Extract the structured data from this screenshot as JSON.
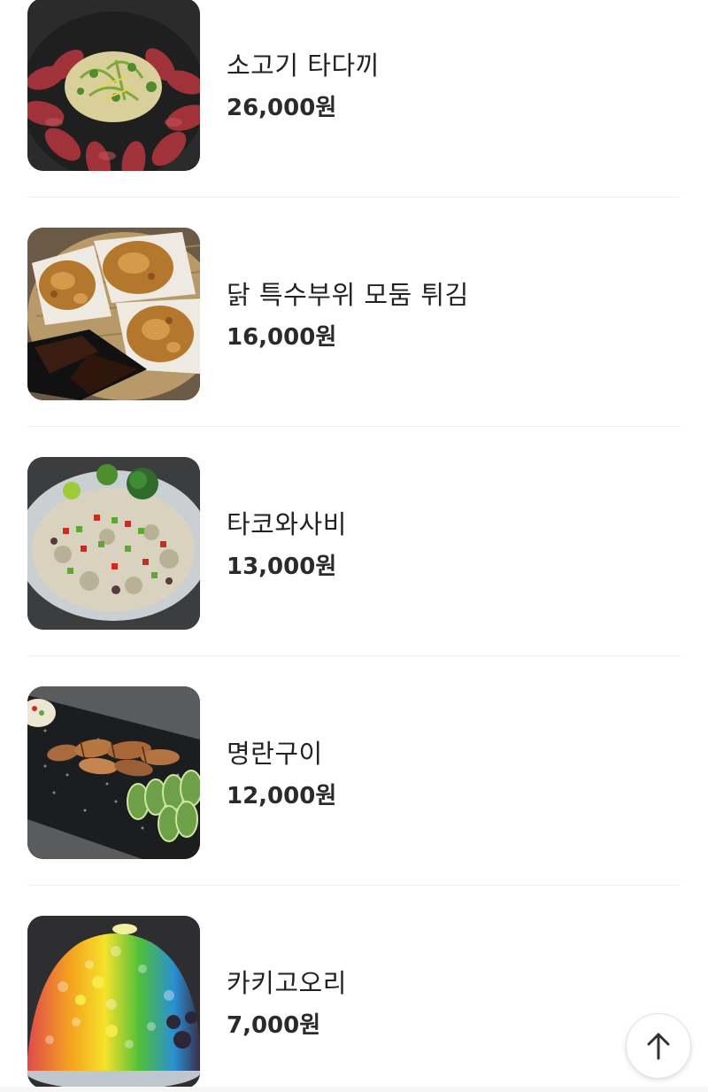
{
  "menu": {
    "items": [
      {
        "name": "소고기 타다끼",
        "price": "26,000원",
        "photo_icon": "beef-tataki-photo"
      },
      {
        "name": "닭 특수부위 모둠 튀김",
        "price": "16,000원",
        "photo_icon": "fried-chicken-photo"
      },
      {
        "name": "타코와사비",
        "price": "13,000원",
        "photo_icon": "tako-wasabi-photo"
      },
      {
        "name": "명란구이",
        "price": "12,000원",
        "photo_icon": "grilled-pollack-roe-photo"
      },
      {
        "name": "카키고오리",
        "price": "7,000원",
        "photo_icon": "kakigori-photo"
      }
    ]
  },
  "scroll_top": {
    "icon": "arrow-up-icon"
  }
}
